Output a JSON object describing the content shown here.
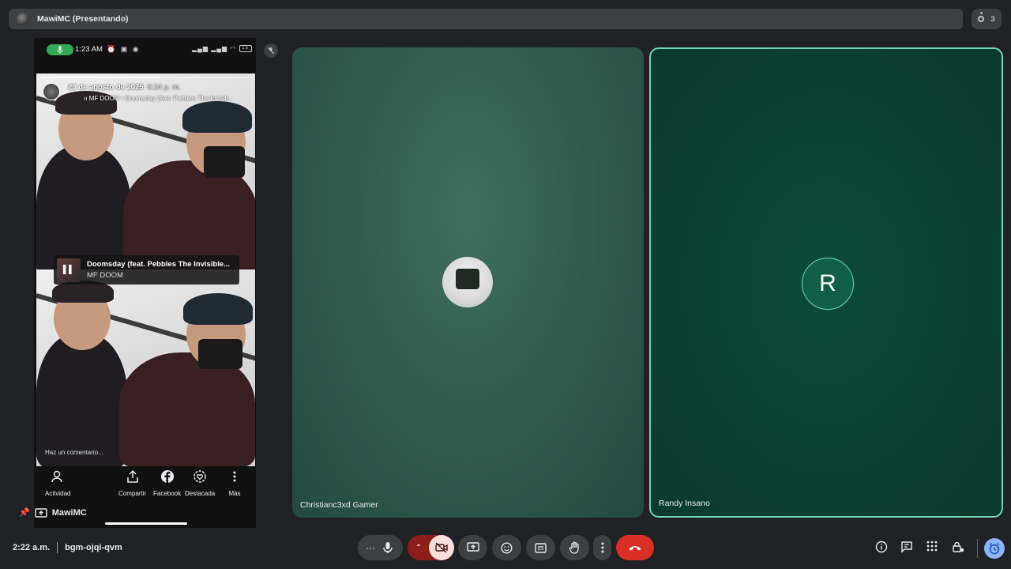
{
  "header": {
    "title": "MawiMC (Presentando)",
    "participant_count": "3"
  },
  "phone_status": {
    "time": "1:23 AM",
    "battery": "15"
  },
  "story": {
    "date": "23 de agosto de 2025",
    "time": "6:24 p. m.",
    "song_line": "MF DOOM • Doomsday (feat. Pebbles The Invisib...",
    "music_title": "Doomsday (feat. Pebbles The Invisible...",
    "music_artist": "MF DOOM",
    "comment_placeholder": "Haz un comentario..."
  },
  "story_actions": {
    "activity": "Actividad",
    "share": "Compartir",
    "facebook": "Facebook",
    "highlight": "Destacada",
    "more": "Más"
  },
  "presenter_name": "MawiMC",
  "tiles": [
    {
      "name": "Christianc3xd Gamer"
    },
    {
      "name": "Randy Insano",
      "initial": "R"
    }
  ],
  "meeting": {
    "time": "2:22 a.m.",
    "code": "bgm-ojqi-qvm"
  },
  "colors": {
    "leave": "#d93025",
    "active_tile_border": "#6fd6b0",
    "cam_off": "#f9dedc"
  }
}
